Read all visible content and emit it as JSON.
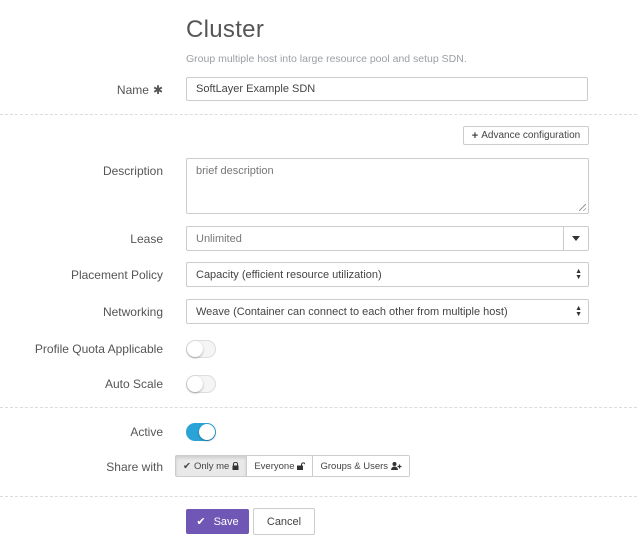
{
  "header": {
    "title": "Cluster",
    "subtitle": "Group multiple host into large resource pool and setup SDN."
  },
  "form": {
    "name": {
      "label": "Name",
      "required_mark": "✱",
      "value": "SoftLayer Example SDN"
    },
    "advance_config_label": "Advance configuration",
    "description": {
      "label": "Description",
      "placeholder": "brief description"
    },
    "lease": {
      "label": "Lease",
      "value": "Unlimited"
    },
    "placement_policy": {
      "label": "Placement Policy",
      "value": "Capacity (efficient resource utilization)"
    },
    "networking": {
      "label": "Networking",
      "value": "Weave (Container can connect to each other from multiple host)"
    },
    "profile_quota": {
      "label": "Profile Quota Applicable",
      "enabled": false
    },
    "auto_scale": {
      "label": "Auto Scale",
      "enabled": false
    },
    "active": {
      "label": "Active",
      "enabled": true
    },
    "share_with": {
      "label": "Share with",
      "options": [
        "Only me",
        "Everyone",
        "Groups & Users"
      ],
      "selected": "Only me"
    }
  },
  "actions": {
    "save_label": "Save",
    "cancel_label": "Cancel"
  },
  "colors": {
    "primary": "#7056b5",
    "toggle_on": "#2aa3d6"
  }
}
